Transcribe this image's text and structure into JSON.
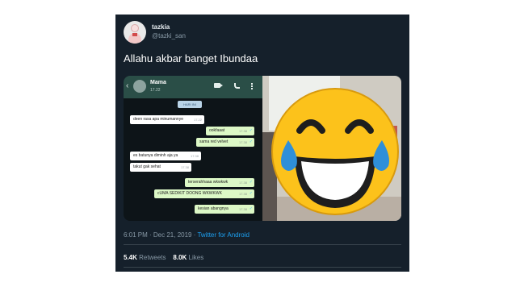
{
  "user": {
    "display_name": "tazkia",
    "handle": "@tazki_san"
  },
  "tweet": {
    "text": "Allahu akbar banget Ibundaa"
  },
  "chat": {
    "contact_name": "Mama",
    "contact_time": "17.22",
    "date_chip": "HARI INI",
    "messages": [
      {
        "dir": "in",
        "text": "deen rasa apa minumannye",
        "time": "17.22"
      },
      {
        "dir": "out",
        "text": "ookfaaat",
        "time": "17.38"
      },
      {
        "dir": "out",
        "text": "sama red velvet",
        "time": "17.38"
      },
      {
        "dir": "in",
        "text": "es batunya diminh aja ya",
        "time": "17.38"
      },
      {
        "dir": "in",
        "text": "takut gak sehat",
        "time": "17.38"
      },
      {
        "dir": "out",
        "text": "terserahhaaa wkwkwk",
        "time": "17.38"
      },
      {
        "dir": "out",
        "text": "cUMA SEDIKIT DOONG WKWKWK",
        "time": "17.38"
      },
      {
        "dir": "out",
        "text": "kesian abangnya",
        "time": "17.38"
      }
    ]
  },
  "meta": {
    "timestamp": "6:01 PM · Dec 21, 2019 ·",
    "client": "Twitter for Android"
  },
  "stats": {
    "retweets_count": "5.4K",
    "retweets_label": "Retweets",
    "likes_count": "8.0K",
    "likes_label": "Likes"
  },
  "colors": {
    "card_bg": "#15202b",
    "link": "#1da1f2",
    "emoji_face": "#fcc21b",
    "emoji_tears": "#2f8fd8"
  },
  "icons": [
    "video-call-icon",
    "phone-call-icon",
    "more-options-icon",
    "back-arrow-icon",
    "tears-of-joy-emoji"
  ]
}
